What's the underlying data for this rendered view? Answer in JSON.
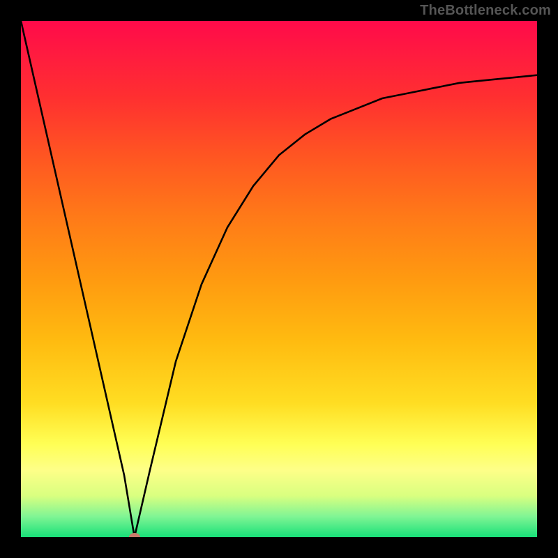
{
  "watermark": "TheBottleneck.com",
  "colors": {
    "frame_bg": "#000000",
    "curve_stroke": "#000000",
    "marker_fill": "#c97a6a",
    "gradient": [
      "#ff0a4a",
      "#ff3030",
      "#ff7a18",
      "#ffbb10",
      "#ffff55",
      "#80f594",
      "#18e079"
    ]
  },
  "chart_data": {
    "type": "line",
    "title": "",
    "xlabel": "",
    "ylabel": "",
    "x": [
      0,
      5,
      10,
      15,
      20,
      22,
      25,
      30,
      35,
      40,
      45,
      50,
      55,
      60,
      65,
      70,
      75,
      80,
      85,
      90,
      95,
      100
    ],
    "values": [
      100,
      78,
      56,
      34,
      12,
      0,
      13,
      34,
      49,
      60,
      68,
      74,
      78,
      81,
      83,
      85,
      86,
      87,
      88,
      88.5,
      89,
      89.5
    ],
    "xlim": [
      0,
      100
    ],
    "ylim": [
      0,
      100
    ],
    "minimum_marker": {
      "x": 22,
      "y": 0
    }
  }
}
